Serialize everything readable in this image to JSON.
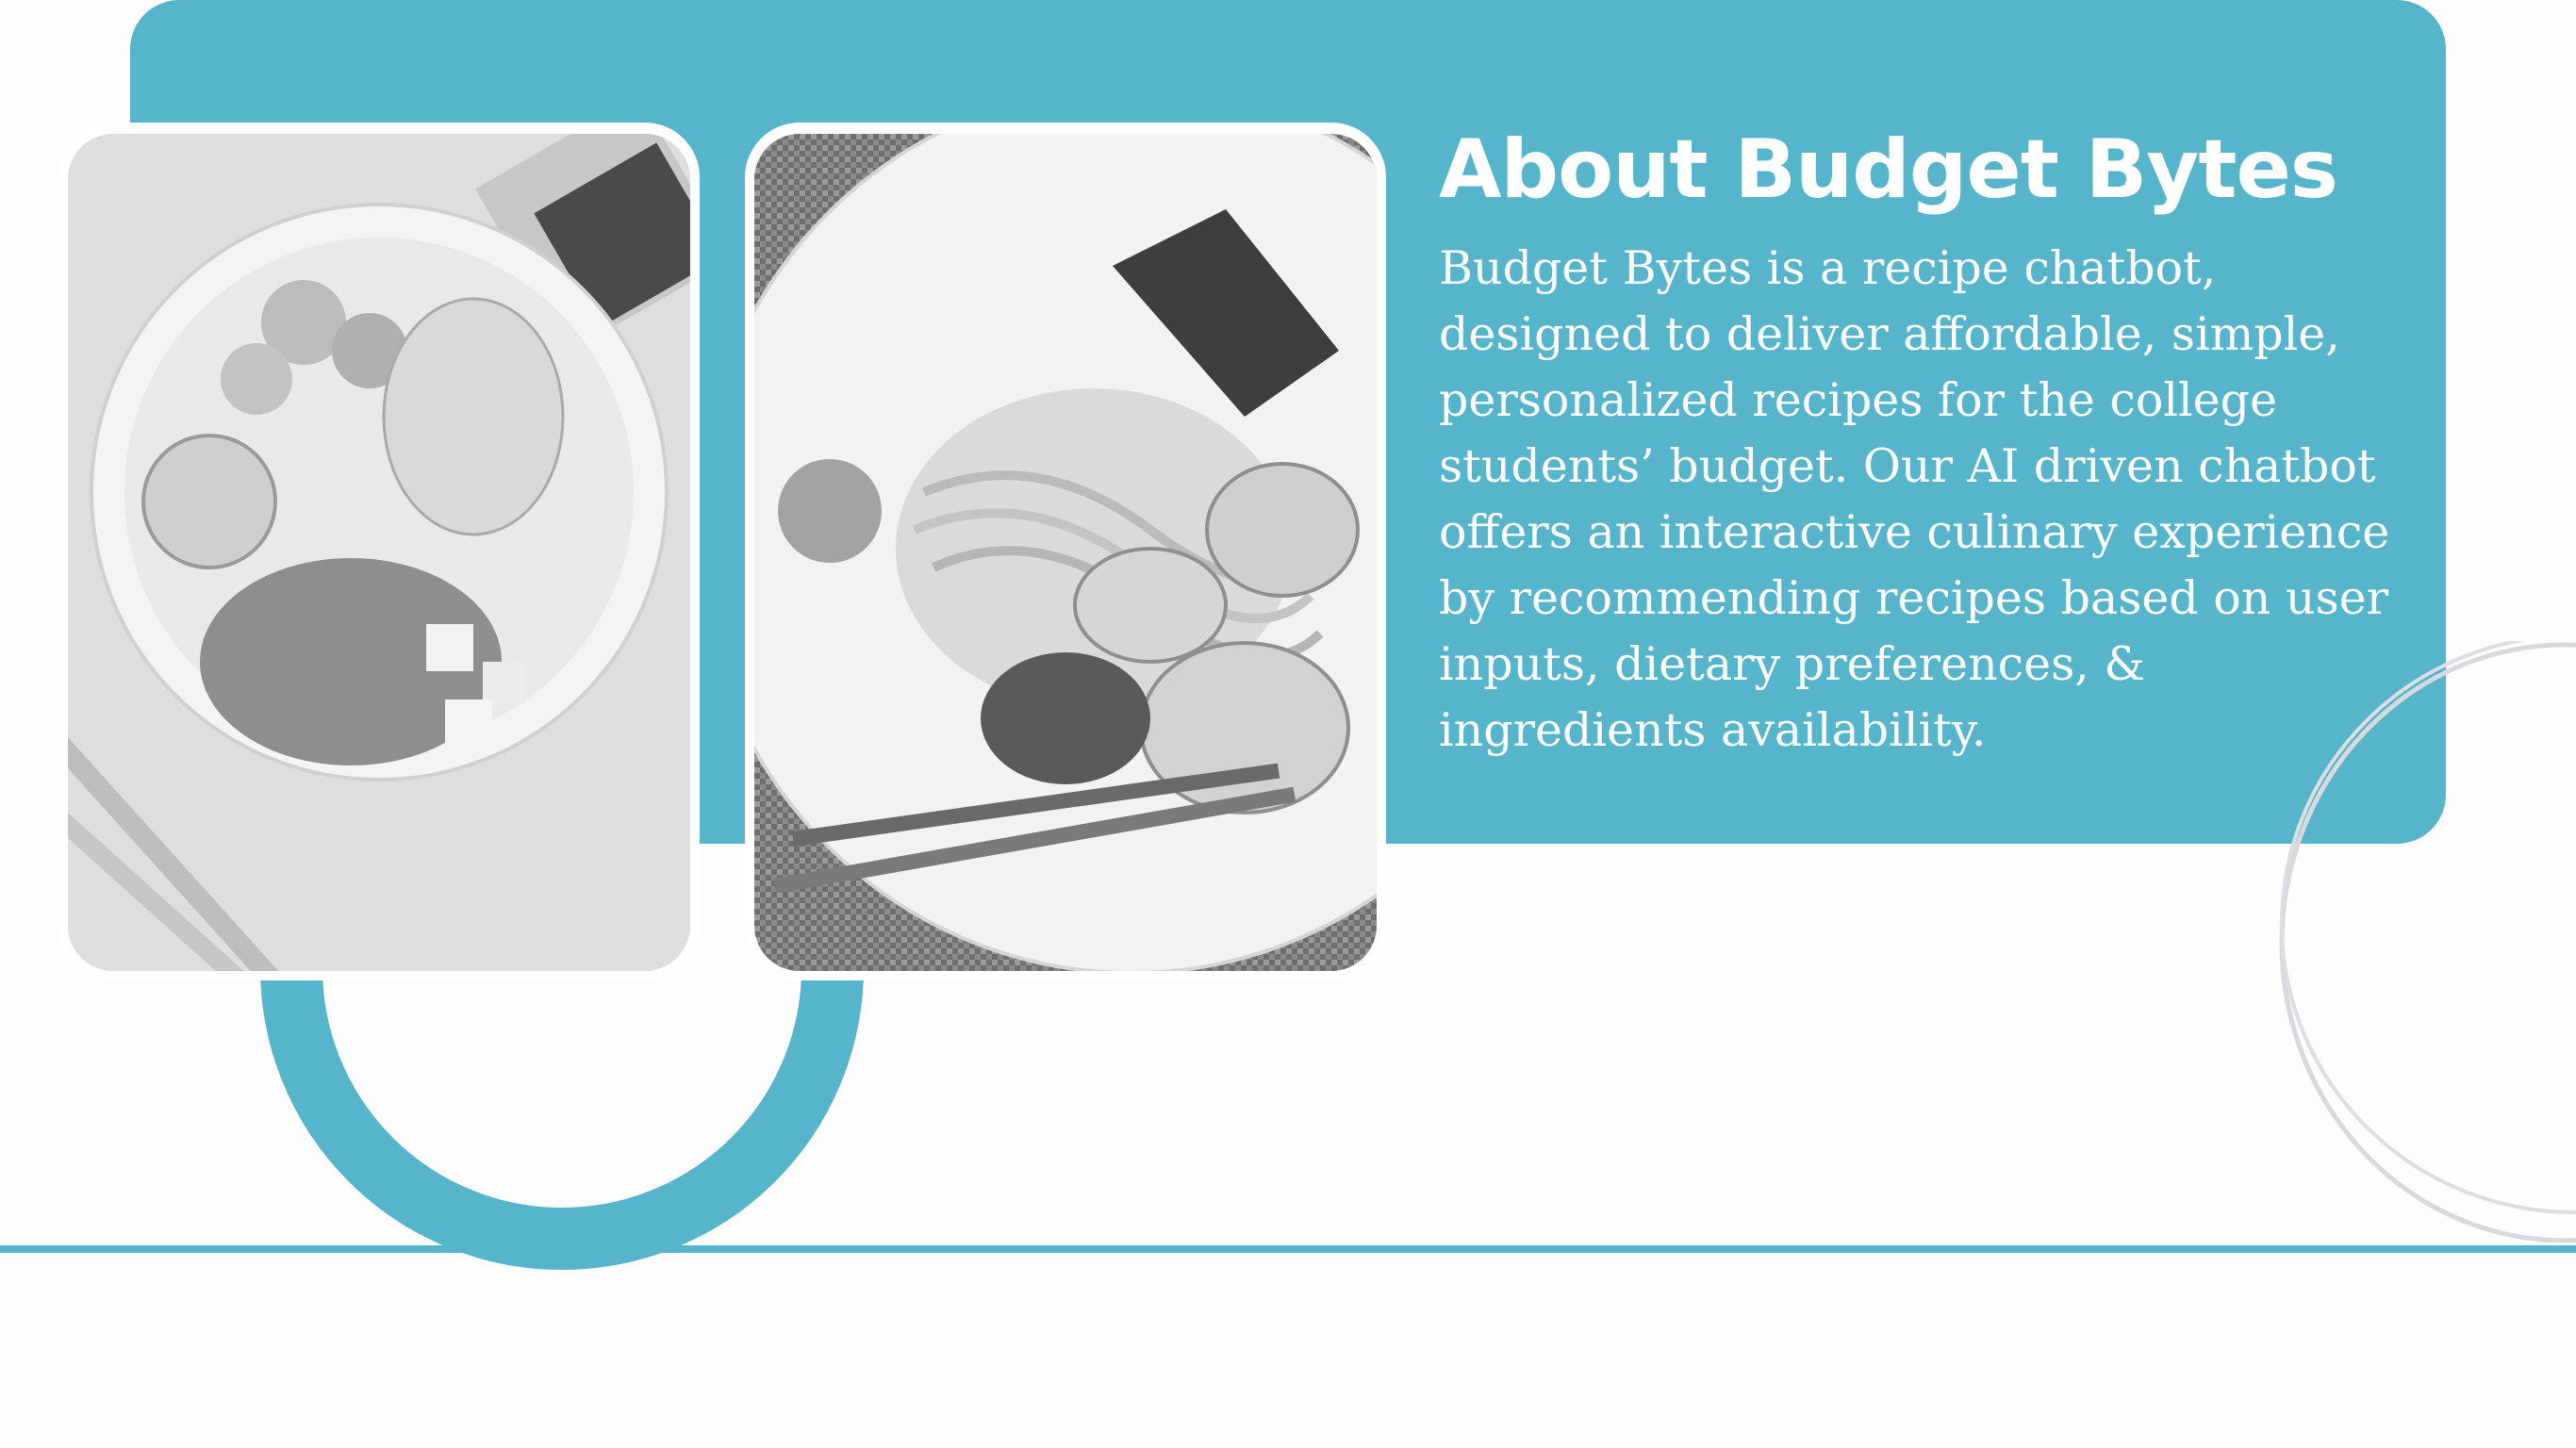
{
  "about": {
    "heading": "About Budget Bytes",
    "description": "Budget Bytes is a recipe chatbot, designed to deliver affordable, simple, personalized recipes for the college students’ budget. Our AI driven chatbot offers an interactive culinary experience by recommending recipes based on user inputs, dietary preferences, & ingredients availability."
  },
  "photos": [
    {
      "icon": "food-bowl-photo"
    },
    {
      "icon": "shrimp-noodle-plate-photo"
    }
  ],
  "theme": {
    "accent": "#56b4cb",
    "background": "#fdfdfd",
    "text": "#ffffff"
  }
}
